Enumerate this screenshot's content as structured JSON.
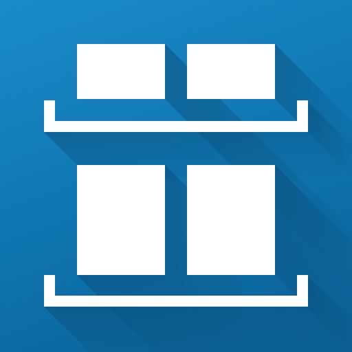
{
  "icon": {
    "name": "shelf-layout-icon",
    "colors": {
      "background_light": "#1a8cc8",
      "background_dark": "#0a5f94",
      "glyph": "#ffffff",
      "long_shadow": "#0a4f7c"
    }
  }
}
